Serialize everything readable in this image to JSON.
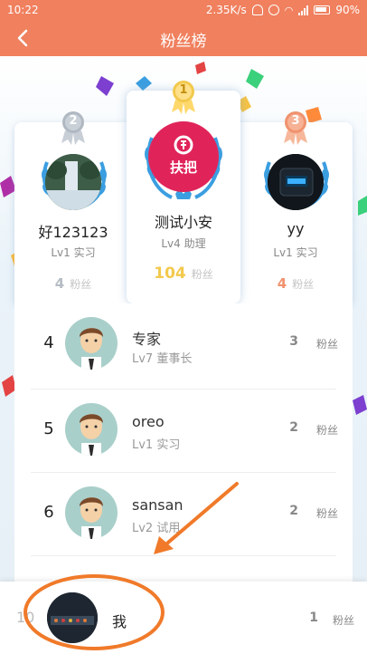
{
  "status_bar": {
    "time": "10:22",
    "speed": "2.35K/s",
    "battery": "90%"
  },
  "header": {
    "title": "粉丝榜",
    "back_icon": "back-arrow-icon"
  },
  "podium": [
    {
      "position": 2,
      "medal": "2",
      "name": "好123123",
      "level": "Lv1 实习",
      "fans": "4",
      "fans_unit": "粉丝",
      "accent": "#b0b8c2"
    },
    {
      "position": 1,
      "medal": "1",
      "name": "测试小安",
      "level": "Lv4 助理",
      "fans": "104",
      "fans_unit": "粉丝",
      "accent": "#f2c94c",
      "avatar_text": "扶把"
    },
    {
      "position": 3,
      "medal": "3",
      "name": "yy",
      "level": "Lv1 实习",
      "fans": "4",
      "fans_unit": "粉丝",
      "accent": "#f0926e"
    }
  ],
  "list": [
    {
      "rank": "4",
      "name": "专家",
      "level": "Lv7 董事长",
      "fans": "3",
      "fans_unit": "粉丝"
    },
    {
      "rank": "5",
      "name": "oreo",
      "level": "Lv1 实习",
      "fans": "2",
      "fans_unit": "粉丝"
    },
    {
      "rank": "6",
      "name": "sansan",
      "level": "Lv2 试用",
      "fans": "2",
      "fans_unit": "粉丝"
    }
  ],
  "me": {
    "rank": "10",
    "name": "我",
    "fans": "1",
    "fans_unit": "粉丝"
  },
  "colors": {
    "header": "#f0805e",
    "gold": "#f2c94c",
    "silver": "#b0b8c2",
    "bronze": "#f0926e",
    "laurel": "#3b9ee0",
    "annotation": "#f07a2a"
  }
}
